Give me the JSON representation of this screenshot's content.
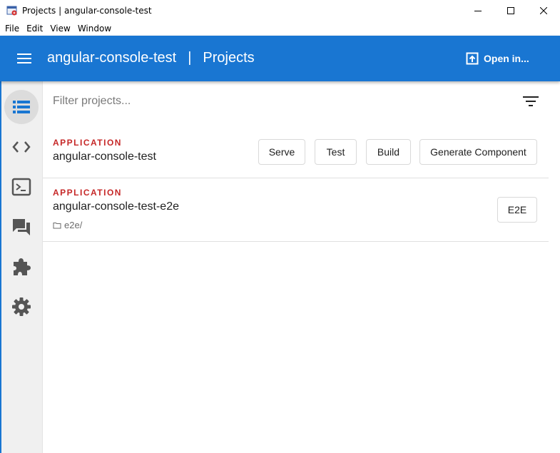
{
  "window": {
    "title": "Projects | angular-console-test"
  },
  "menu": [
    "File",
    "Edit",
    "View",
    "Window"
  ],
  "toolbar": {
    "workspace": "angular-console-test",
    "separator": "|",
    "page": "Projects",
    "open_in_label": "Open in..."
  },
  "sidebar": {
    "items": [
      {
        "icon": "list-icon",
        "active": true
      },
      {
        "icon": "code-icon",
        "active": false
      },
      {
        "icon": "terminal-icon",
        "active": false
      },
      {
        "icon": "forum-icon",
        "active": false
      },
      {
        "icon": "extension-icon",
        "active": false
      },
      {
        "icon": "settings-icon",
        "active": false
      }
    ]
  },
  "filter": {
    "placeholder": "Filter projects..."
  },
  "projects": [
    {
      "type": "APPLICATION",
      "name": "angular-console-test",
      "root": "",
      "actions": [
        "Serve",
        "Test",
        "Build",
        "Generate Component"
      ]
    },
    {
      "type": "APPLICATION",
      "name": "angular-console-test-e2e",
      "root": "e2e/",
      "actions": [
        "E2E"
      ]
    }
  ],
  "colors": {
    "primary": "#1976d2",
    "type_label": "#c62828",
    "sidebar_bg": "#f0f0f0"
  }
}
